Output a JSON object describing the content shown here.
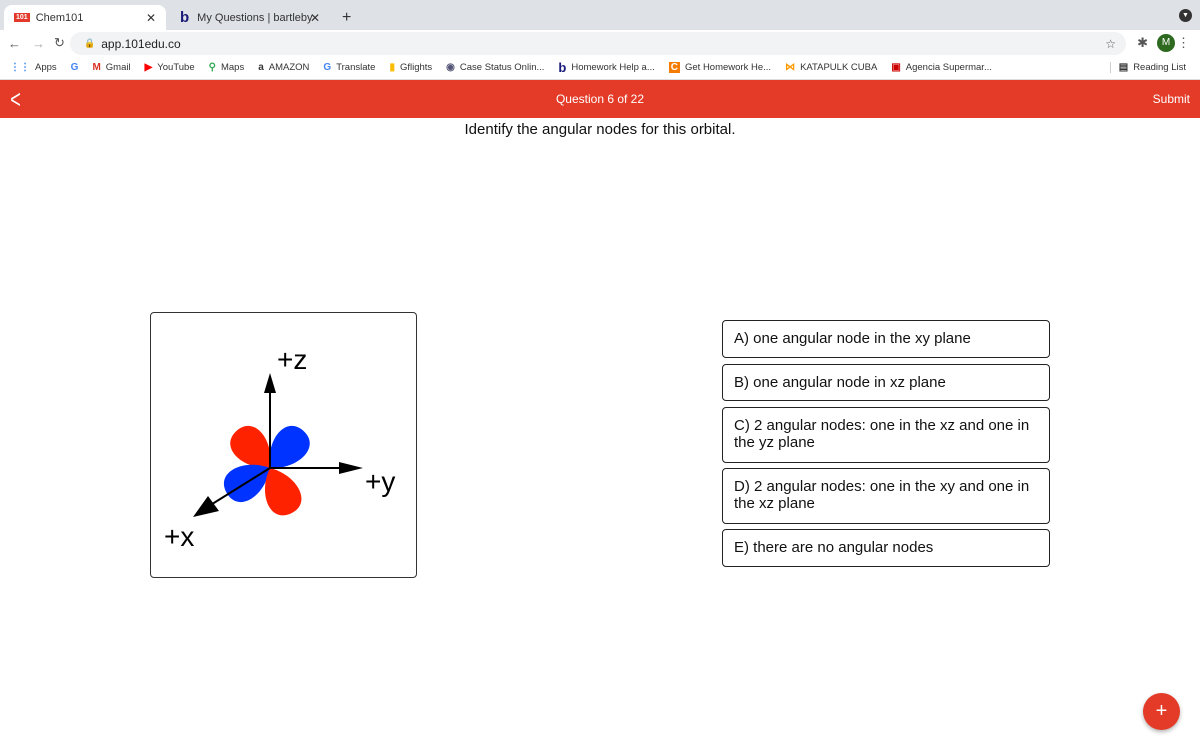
{
  "browser": {
    "tabs": [
      {
        "label": "Chem101",
        "favicon": "101"
      },
      {
        "label": "My Questions | bartleby",
        "favicon": "b"
      }
    ],
    "url": "app.101edu.co",
    "profile_initial": "M",
    "bookmarks": [
      "Apps",
      "Gmail",
      "YouTube",
      "Maps",
      "AMAZON",
      "Translate",
      "Gflights",
      "Case Status Onlin...",
      "Homework Help a...",
      "Get Homework He...",
      "KATAPULK CUBA",
      "Agencia Supermar..."
    ],
    "reading_list": "Reading List"
  },
  "header": {
    "title": "Question 6 of 22",
    "submit": "Submit"
  },
  "question": "Identify the angular nodes for this orbital.",
  "figure": {
    "labels": {
      "z": "+z",
      "y": "+y",
      "x": "+x"
    },
    "colors": {
      "positive": "#ff2200",
      "negative": "#0033ff"
    }
  },
  "options": [
    "A) one angular node in the xy plane",
    "B) one angular node in xz plane",
    "C)  2 angular nodes: one in the xz and one in the yz plane",
    "D) 2 angular nodes: one in the xy and one in the xz plane",
    "E) there are no angular nodes"
  ],
  "fab": "+",
  "accent": "#e33b27"
}
